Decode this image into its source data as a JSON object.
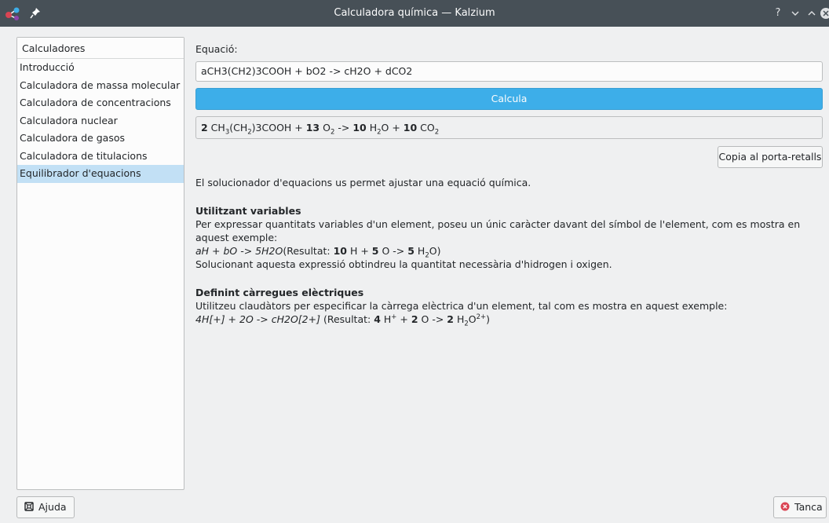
{
  "window": {
    "title": "Calculadora química — Kalzium",
    "buttons": [
      "?",
      "⌄",
      "⌃",
      "✕"
    ]
  },
  "sidebar": {
    "header": "Calculadores",
    "items": [
      {
        "label": "Introducció"
      },
      {
        "label": "Calculadora de massa molecular"
      },
      {
        "label": "Calculadora de concentracions"
      },
      {
        "label": "Calculadora nuclear"
      },
      {
        "label": "Calculadora de gasos"
      },
      {
        "label": "Calculadora de titulacions"
      },
      {
        "label": "Equilibrador d'equacions",
        "selected": true
      }
    ]
  },
  "main": {
    "equation_label": "Equació:",
    "equation_value": "aCH3(CH2)3COOH + bO2 -> cH2O + dCO2",
    "calculate_label": "Calcula",
    "result": {
      "c1": "2",
      "s1a": " CH",
      "s1b": "3",
      "s1c": "(CH",
      "s1d": "2",
      "s1e": ")3COOH + ",
      "c2": "13",
      "s2a": " O",
      "s2b": "2",
      "s2c": " -> ",
      "c3": "10",
      "s3a": " H",
      "s3b": "2",
      "s3c": "O + ",
      "c4": "10",
      "s4a": " CO",
      "s4b": "2"
    },
    "copy_label": "Copia al porta-retalls",
    "help": {
      "intro": "El solucionador d'equacions us permet ajustar una equació química.",
      "vars_title": "Utilitzant variables",
      "vars_text": "Per expressar quantitats variables d'un element, poseu un únic caràcter davant del símbol de l'element, com es mostra en aquest exemple:",
      "vars_example": "aH + bO -> 5H2O",
      "vars_result_prefix": "(Resultat: ",
      "vars_r_c1": "10",
      "vars_r_s1": " H + ",
      "vars_r_c2": "5",
      "vars_r_s2": " O -> ",
      "vars_r_c3": "5",
      "vars_r_s3a": " H",
      "vars_r_s3b": "2",
      "vars_r_s3c": "O)",
      "vars_note": "Solucionant aquesta expressió obtindreu la quantitat necessària d'hidrogen i oxigen.",
      "charges_title": "Definint càrregues elèctriques",
      "charges_text": "Utilitzeu claudàtors per especificar la càrrega elèctrica d'un element, tal com es mostra en aquest exemple:",
      "charges_example": "4H[+] + 2O -> cH2O[2+]",
      "charges_result_prefix": " (Resultat: ",
      "ch_r_c1": "4",
      "ch_r_s1a": " H",
      "ch_r_s1b": "+",
      "ch_r_s1c": " + ",
      "ch_r_c2": "2",
      "ch_r_s2": " O -> ",
      "ch_r_c3": "2",
      "ch_r_s3a": " H",
      "ch_r_s3b": "2",
      "ch_r_s3c": "O",
      "ch_r_s3d": "2+",
      "ch_r_s3e": ")"
    }
  },
  "footer": {
    "help_label": "Ajuda",
    "close_label": "Tanca"
  },
  "colors": {
    "titlebar": "#475057",
    "accent": "#3daee9",
    "selection": "#c2e0f5",
    "close_icon": "#da4453"
  }
}
